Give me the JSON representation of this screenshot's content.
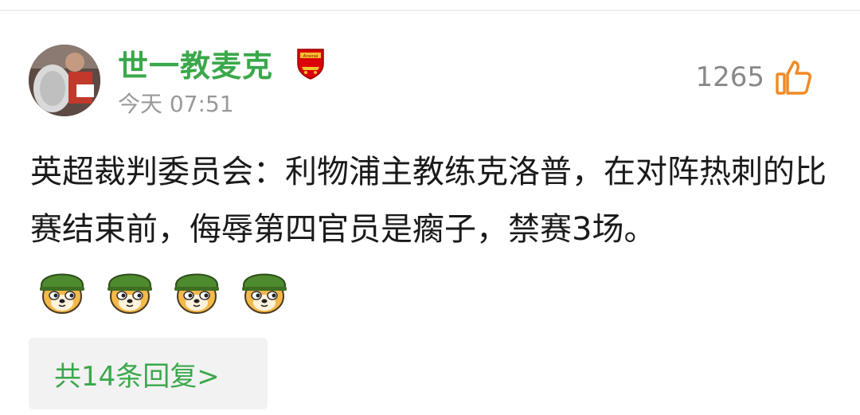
{
  "comment": {
    "username": "世一教麦克",
    "team_badge": {
      "icon": "arsenal-badge-icon",
      "text": "Arsenal"
    },
    "timestamp": "今天 07:51",
    "likes": {
      "count": "1265",
      "icon": "thumbs-up-icon"
    },
    "text": "英超裁判委员会：利物浦主教练克洛普，在对阵热刺的比赛结束前，侮辱第四官员是瘸子，禁赛3场。",
    "emojis": [
      "helmet-dog-emoji",
      "helmet-dog-emoji",
      "helmet-dog-emoji",
      "helmet-dog-emoji"
    ],
    "replies_link": "共14条回复>"
  },
  "colors": {
    "username": "#3aa84b",
    "link": "#3aa84b",
    "like_icon": "#f08a24",
    "muted": "#999999",
    "reply_bg": "#f2f2f2"
  }
}
